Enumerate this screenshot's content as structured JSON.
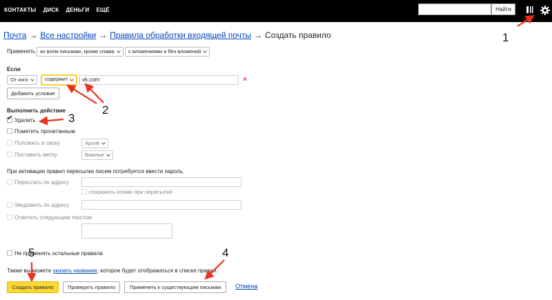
{
  "topnav": [
    "КОНТАКТЫ",
    "ДИСК",
    "ДЕНЬГИ",
    "ЕЩЁ"
  ],
  "search": {
    "button": "Найти"
  },
  "breadcrumb": {
    "items": [
      "Почта",
      "Все настройки",
      "Правила обработки входящей почты"
    ],
    "current": "Создать правило",
    "separator": "→"
  },
  "apply": {
    "label": "Применять",
    "scope": "ко всем письмам, кроме спама",
    "attachments": "с вложениями и без вложений"
  },
  "condition": {
    "heading": "Если",
    "field": "От кого",
    "operator": "содержит",
    "value": "vk.com",
    "remove": "×",
    "add_button": "Добавить условие"
  },
  "actions": {
    "heading": "Выполнить действие",
    "delete": "Удалить",
    "mark_read": "Пометить прочитанным",
    "move_to_folder": "Положить в папку",
    "folder_value": "Архив",
    "set_label": "Поставить метку",
    "label_value": "Важные"
  },
  "forwarding": {
    "note": "При активации правил пересылки писем потребуется ввести пароль.",
    "forward": "Переслать по адресу",
    "keep_copy": "сохранить копию при пересылке",
    "notify": "Уведомить по адресу",
    "reply": "Ответить следующим текстом"
  },
  "stop_rules": "Не применять остальные правила",
  "name_hint": {
    "before": "Также вы можете ",
    "link": "указать название",
    "after": ", которое будет отображаться в списке правил."
  },
  "buttons": {
    "create": "Создать правило",
    "check": "Проверить правило",
    "apply_existing": "Применить к существующим письмам",
    "cancel": "Отмена"
  },
  "annotations": [
    "1",
    "2",
    "3",
    "4",
    "5"
  ],
  "colors": {
    "topbar": "#000000",
    "link": "#0044bb",
    "primary": "#fcd836",
    "highlight": "#f7cf2f",
    "arrow": "#e8321e"
  }
}
